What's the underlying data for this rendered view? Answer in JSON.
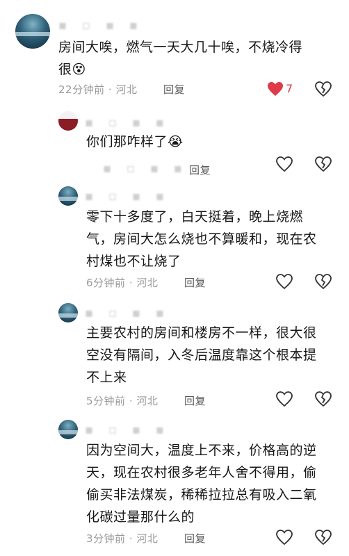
{
  "comments": [
    {
      "text_line1": "房间大唉，燃气一天大几十唉，不烧冷得",
      "text_line2": "很",
      "emoji": "😵",
      "time": "22分钟前",
      "location": "河北",
      "reply_label": "回复",
      "likes": "7"
    },
    {
      "text": "你们那咋样了",
      "emoji": "😭",
      "reply_label": "回复"
    },
    {
      "lines": [
        "零下十多度了，白天挺着，晚上烧燃",
        "气，房间大怎么烧也不算暖和，现在农",
        "村煤也不让烧了"
      ],
      "time": "6分钟前",
      "location": "河北",
      "reply_label": "回复"
    },
    {
      "lines": [
        "主要农村的房间和楼房不一样，很大很",
        "空没有隔间，入冬后温度靠这个根本提",
        "不上来"
      ],
      "time": "5分钟前",
      "location": "河北",
      "reply_label": "回复"
    },
    {
      "lines": [
        "因为空间大，温度上不来，价格高的逆",
        "天，现在农村很多老年人舍不得用，偷",
        "偷买非法煤炭，稀稀拉拉总有吸入二氧",
        "化碳过量那什么的"
      ],
      "time": "3分钟前",
      "location": "河北",
      "reply_label": "回复"
    }
  ],
  "separator": "·",
  "blurred": "▪ ▫ ▪ ▪",
  "like_color": "#e0394a"
}
